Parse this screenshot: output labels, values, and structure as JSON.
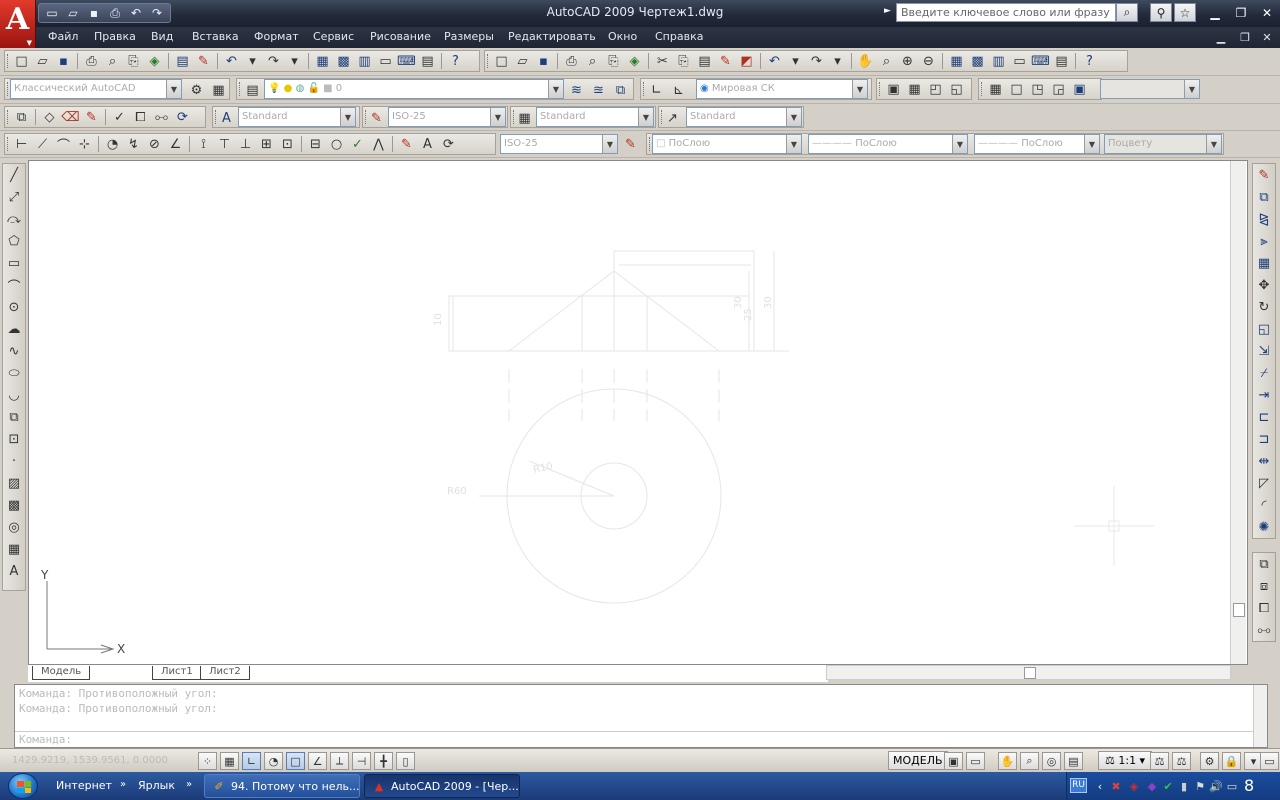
{
  "window": {
    "title": "AutoCAD 2009 Чертеж1.dwg",
    "search_placeholder": "Введите ключевое слово или фразу",
    "logo_letter": "A"
  },
  "menu": [
    "Файл",
    "Правка",
    "Вид",
    "Вставка",
    "Формат",
    "Сервис",
    "Рисование",
    "Размеры",
    "Редактировать",
    "Окно",
    "Справка"
  ],
  "toolbars": {
    "workspace": "Классический AutoCAD",
    "layer": "0",
    "view_style": "Мировая СК",
    "text_style": "Standard",
    "dim_style": "ISO-25",
    "table_style": "Standard",
    "mleader_style": "Standard",
    "annot_scale": "ISO-25",
    "color": "ПоСлою",
    "linetype": "ПоСлою",
    "lineweight": "ПоСлою",
    "plot_style": "Поцвету"
  },
  "drawing": {
    "labels": [
      "10",
      "30",
      "30",
      "25",
      "R10",
      "R60"
    ],
    "axis_x": "X",
    "axis_y": "Y"
  },
  "layout_tabs": [
    "Модель",
    "Лист1",
    "Лист2"
  ],
  "command": {
    "history": [
      "Команда: Противоположный угол:",
      "Команда: Противоположный угол:"
    ],
    "prompt": "Команда:"
  },
  "status": {
    "coords": "1429.9219, 1539.9561, 0.0000",
    "model": "МОДЕЛЬ",
    "scale": "1:1"
  },
  "taskbar": {
    "internet": "Интернет",
    "shortcut": "Ярлык",
    "task1": "94. Потому что нель...",
    "task2": "AutoCAD 2009 - [Чер...",
    "lang": "RU",
    "time": "8"
  }
}
